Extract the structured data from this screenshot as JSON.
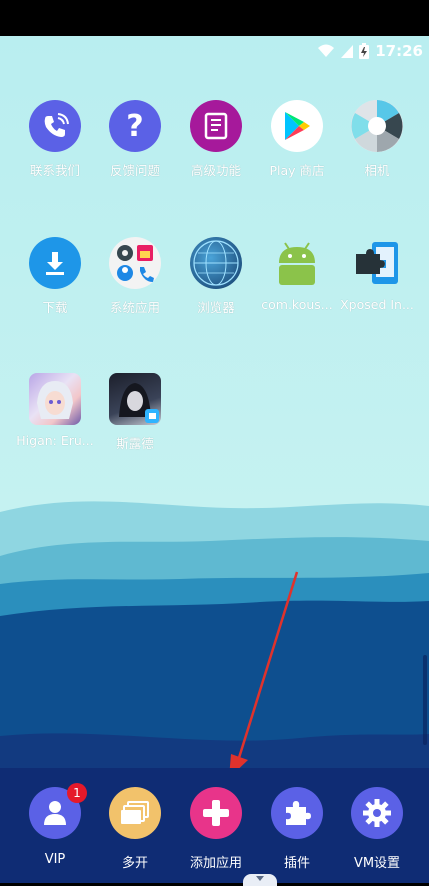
{
  "status_bar": {
    "time": "17:26"
  },
  "apps": [
    {
      "label": "联系我们",
      "icon": "phone-icon",
      "color": "#5b61e6"
    },
    {
      "label": "反馈问题",
      "icon": "question-icon",
      "color": "#5b61e6"
    },
    {
      "label": "高级功能",
      "icon": "book-icon",
      "color": "#a6199b"
    },
    {
      "label": "Play 商店",
      "icon": "play-store-icon",
      "color": "#ffffff"
    },
    {
      "label": "相机",
      "icon": "camera-icon",
      "color": "#e6e9ed"
    },
    {
      "label": "下载",
      "icon": "download-icon",
      "color": "#1e96e8"
    },
    {
      "label": "系统应用",
      "icon": "system-apps-icon",
      "color": "#f3f3f3"
    },
    {
      "label": "浏览器",
      "icon": "browser-globe-icon",
      "color": "#1d4d7d"
    },
    {
      "label": "com.kous...",
      "icon": "android-icon",
      "color": "#8bc34a"
    },
    {
      "label": "Xposed In...",
      "icon": "xposed-puzzle-icon",
      "color": "#1e96e8"
    },
    {
      "label": "Higan: Eru...",
      "icon": "game-avatar-icon",
      "color": "#c9b6e6"
    },
    {
      "label": "斯露德",
      "icon": "game-avatar-icon",
      "color": "#2b3140"
    }
  ],
  "dock": [
    {
      "label": "VIP",
      "icon": "user-icon",
      "color": "#5b61e6",
      "badge": "1"
    },
    {
      "label": "多开",
      "icon": "multi-window-icon",
      "color": "#f2c26b"
    },
    {
      "label": "添加应用",
      "icon": "plus-icon",
      "color": "#e8348a"
    },
    {
      "label": "插件",
      "icon": "puzzle-icon",
      "color": "#5b61e6"
    },
    {
      "label": "VM设置",
      "icon": "gear-icon",
      "color": "#5b61e6"
    }
  ]
}
